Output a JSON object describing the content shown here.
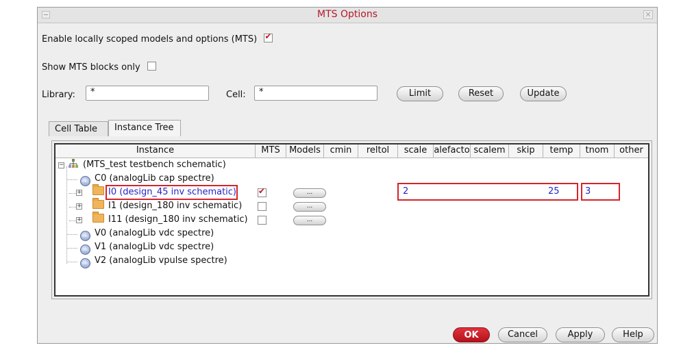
{
  "window": {
    "title": "MTS Options"
  },
  "options": {
    "enable_mts_label": "Enable locally scoped models and options (MTS)",
    "enable_mts_checked": true,
    "show_blocks_label": "Show MTS blocks only",
    "show_blocks_checked": false
  },
  "filter": {
    "library_label": "Library:",
    "library_value": "*",
    "cell_label": "Cell:",
    "cell_value": "*",
    "limit_button": "Limit",
    "reset_button": "Reset",
    "update_button": "Update"
  },
  "tabs": [
    {
      "label": "Cell Table",
      "active": false
    },
    {
      "label": "Instance Tree",
      "active": true
    }
  ],
  "table": {
    "columns": [
      "Instance",
      "MTS",
      "Models",
      "cmin",
      "reltol",
      "scale",
      "alefacto",
      "scalem",
      "skip",
      "temp",
      "tnom",
      "other"
    ],
    "rows": [
      {
        "label": "(MTS_test testbench schematic)",
        "icon": "hierarchy-icon"
      },
      {
        "label": "C0 (analogLib cap spectre)",
        "icon": "instance-icon"
      },
      {
        "label": "I0 (design_45 inv schematic)",
        "icon": "folder-icon",
        "mts": true,
        "models": "...",
        "scale": "2",
        "temp": "25",
        "tnom": "3"
      },
      {
        "label": "I1 (design_180 inv schematic)",
        "icon": "folder-icon",
        "mts": false,
        "models": "..."
      },
      {
        "label": "I11 (design_180 inv schematic)",
        "icon": "folder-icon",
        "mts": false,
        "models": "..."
      },
      {
        "label": "V0 (analogLib vdc spectre)",
        "icon": "instance-icon"
      },
      {
        "label": "V1 (analogLib vdc spectre)",
        "icon": "instance-icon"
      },
      {
        "label": "V2 (analogLib vpulse spectre)",
        "icon": "instance-icon"
      }
    ]
  },
  "buttons": {
    "ok": "OK",
    "cancel": "Cancel",
    "apply": "Apply",
    "help": "Help"
  },
  "colors": {
    "title": "#b5172a",
    "accent_red": "#d6222c",
    "link_blue": "#2424c8"
  }
}
